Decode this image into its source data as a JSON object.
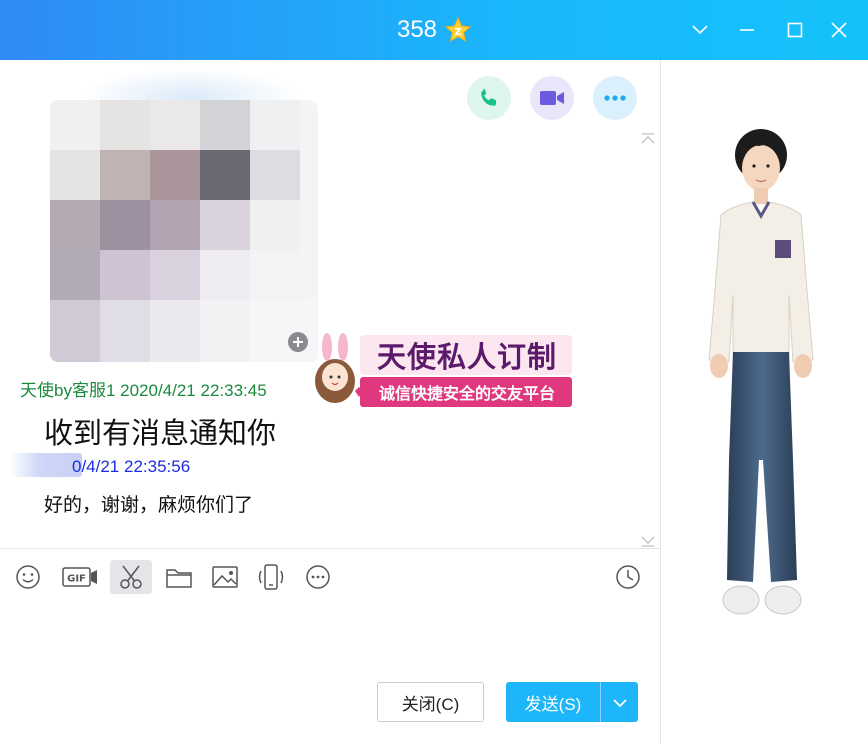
{
  "window": {
    "title": "358",
    "icons": [
      "star-badge-icon",
      "chevron-down-icon",
      "minimize-icon",
      "maximize-icon",
      "close-icon"
    ]
  },
  "actions": {
    "icons": [
      "phone-icon",
      "video-icon",
      "more-icon"
    ]
  },
  "messages": [
    {
      "sender_time": "天使by客服1 2020/4/21 22:33:45",
      "text": "收到有消息通知你",
      "color": "#1a8a3e"
    },
    {
      "sender_time": "0/4/21 22:35:56",
      "text": "好的，谢谢，麻烦你们了",
      "color": "#1a2ee0"
    }
  ],
  "banner": {
    "title": "天使私人订制",
    "subtitle": "诚信快捷安全的交友平台"
  },
  "toolbar": {
    "icons": [
      "emoji-icon",
      "gif-icon",
      "scissors-icon",
      "folder-icon",
      "image-icon",
      "shake-icon",
      "more-dots-icon",
      "history-clock-icon"
    ]
  },
  "buttons": {
    "close_label": "关闭(C)",
    "send_label": "发送(S)"
  },
  "colors": {
    "title_gradient_start": "#2f8bf5",
    "title_gradient_end": "#14c2fb",
    "send_button": "#1eb6fb",
    "sender_green": "#1a8a3e",
    "sender_blue": "#1a2ee0"
  }
}
